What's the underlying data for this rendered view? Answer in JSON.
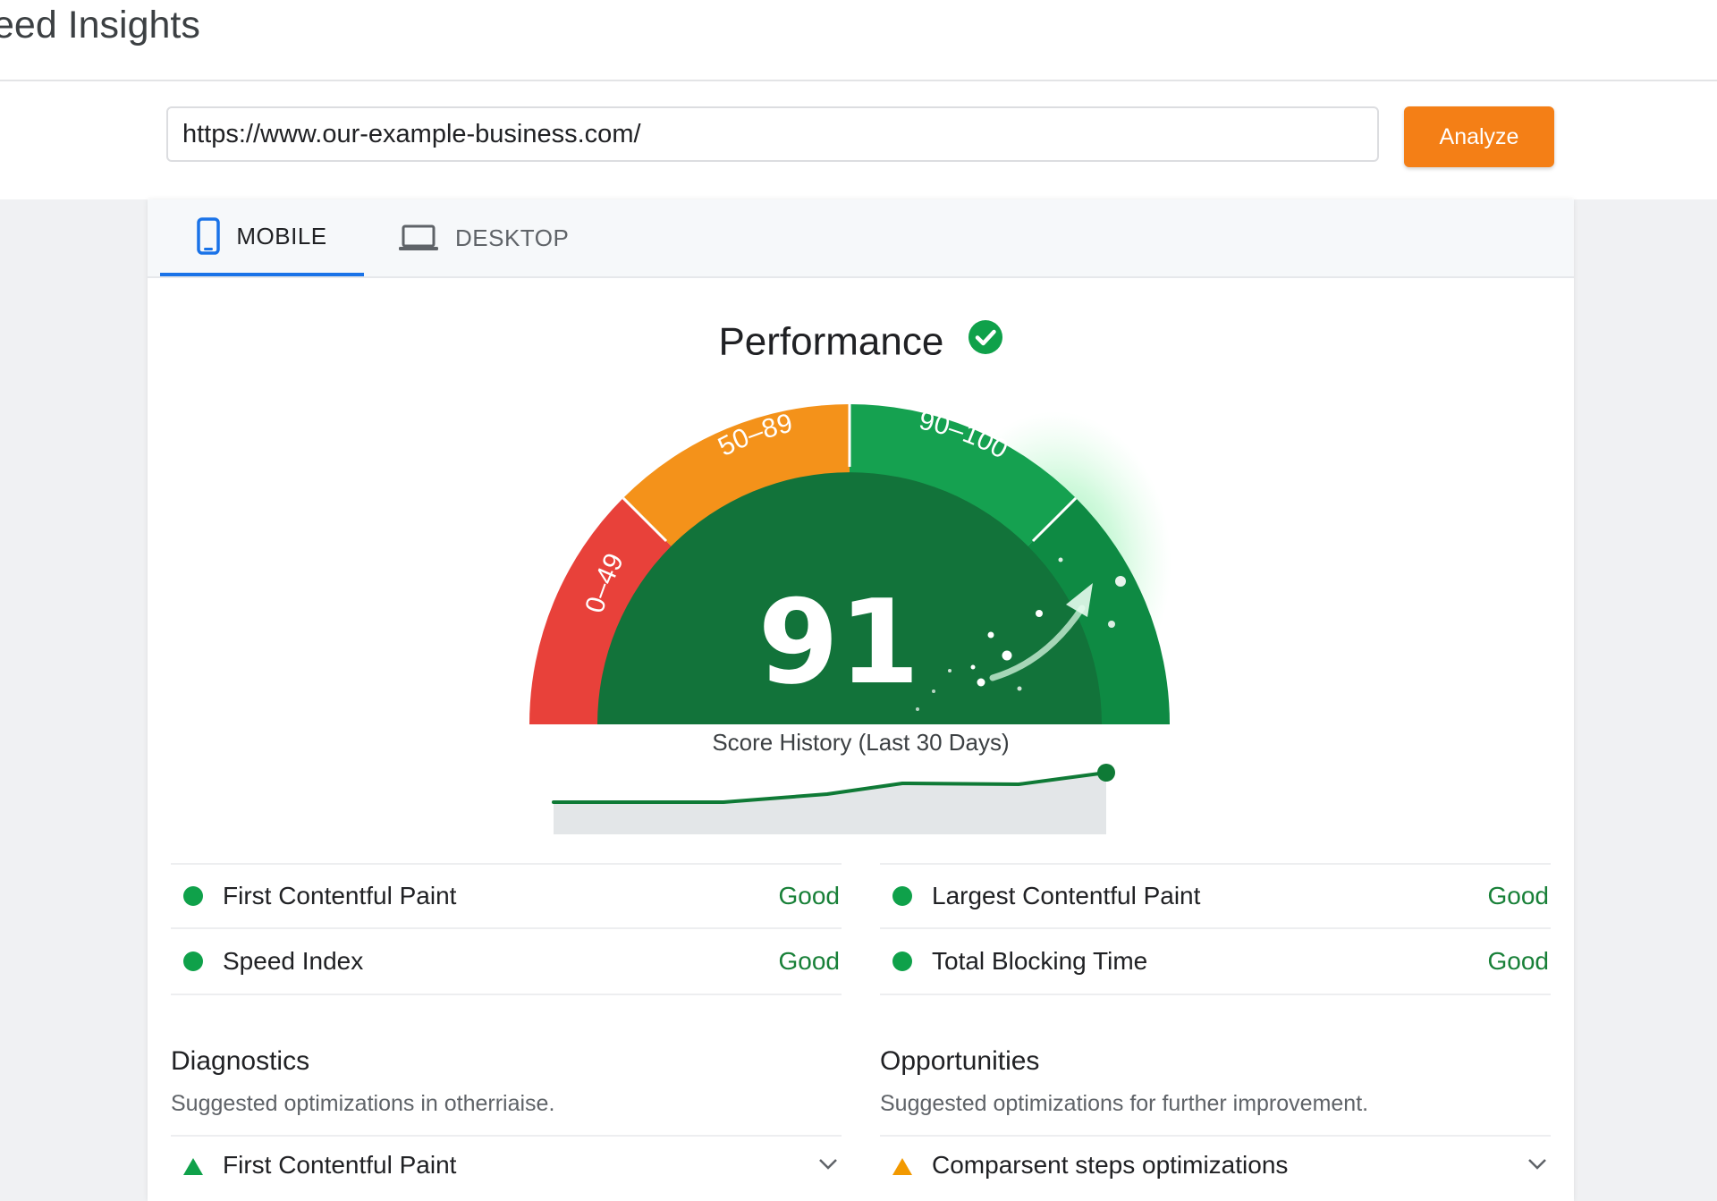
{
  "header": {
    "app_title": "eed Insights"
  },
  "search": {
    "url_value": "https://www.our-example-business.com/",
    "analyze_label": "Analyze"
  },
  "tabs": [
    {
      "label": "MOBILE",
      "icon": "phone-icon",
      "active": true
    },
    {
      "label": "DESKTOP",
      "icon": "laptop-icon",
      "active": false
    }
  ],
  "performance": {
    "title": "Performance",
    "score": "91",
    "score_value": 91,
    "ranges": [
      "0–49",
      "50–89",
      "90–100"
    ],
    "history_label": "Score History (Last 30 Days)"
  },
  "metrics": [
    {
      "name": "First Contentful Paint",
      "status": "Good"
    },
    {
      "name": "Largest Contentful Paint",
      "status": "Good"
    },
    {
      "name": "Speed Index",
      "status": "Good"
    },
    {
      "name": "Total Blocking Time",
      "status": "Good"
    }
  ],
  "diagnostics": {
    "title": "Diagnostics",
    "subtitle": "Suggested optimizations in otherriaise.",
    "first_item": "First Contentful Paint"
  },
  "opportunities": {
    "title": "Opportunities",
    "subtitle": "Suggested optimizations for further improvement.",
    "first_item": "Comparsent steps optimizations"
  },
  "colors": {
    "accent": "#f47f16",
    "tab_active": "#1a73e8",
    "good": "#0fa14a",
    "good_text": "#188038",
    "gauge_red": "#e8413a",
    "gauge_orange": "#f4921a",
    "gauge_green": "#15a150",
    "gauge_center": "#12733a"
  }
}
